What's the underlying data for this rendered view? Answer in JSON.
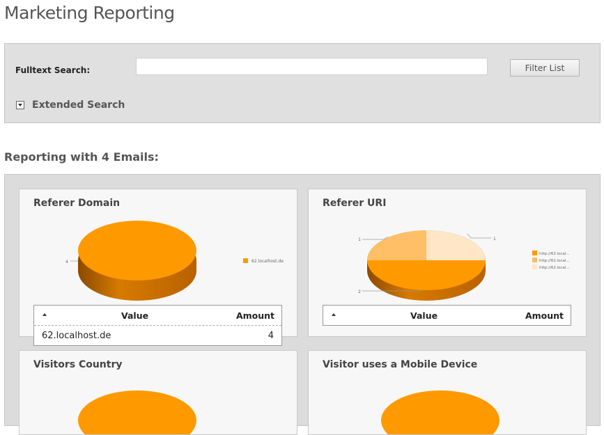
{
  "page": {
    "title": "Marketing Reporting"
  },
  "search": {
    "label": "Fulltext Search:",
    "value": "",
    "filter_button": "Filter List",
    "extended_label": "Extended Search"
  },
  "report": {
    "heading": "Reporting with 4 Emails:",
    "cards": [
      {
        "title": "Referer Domain",
        "chart": {
          "type": "pie",
          "labels": [
            "62.localhost.de"
          ],
          "values": [
            4
          ],
          "colors": [
            "#ff9900"
          ]
        },
        "table": {
          "headers": [
            "Value",
            "Amount"
          ],
          "rows": [
            {
              "value": "62.localhost.de",
              "amount": "4"
            }
          ]
        }
      },
      {
        "title": "Referer URI",
        "chart": {
          "type": "pie",
          "labels": [
            "http://62.local...",
            "http://62.local...",
            "http://62.local..."
          ],
          "values": [
            2,
            1,
            1
          ],
          "colors": [
            "#ff9900",
            "#ffbf66",
            "#ffe6c7"
          ]
        },
        "table": {
          "headers": [
            "Value",
            "Amount"
          ],
          "rows": []
        }
      },
      {
        "title": "Visitors Country"
      },
      {
        "title": "Visitor uses a Mobile Device"
      }
    ]
  }
}
